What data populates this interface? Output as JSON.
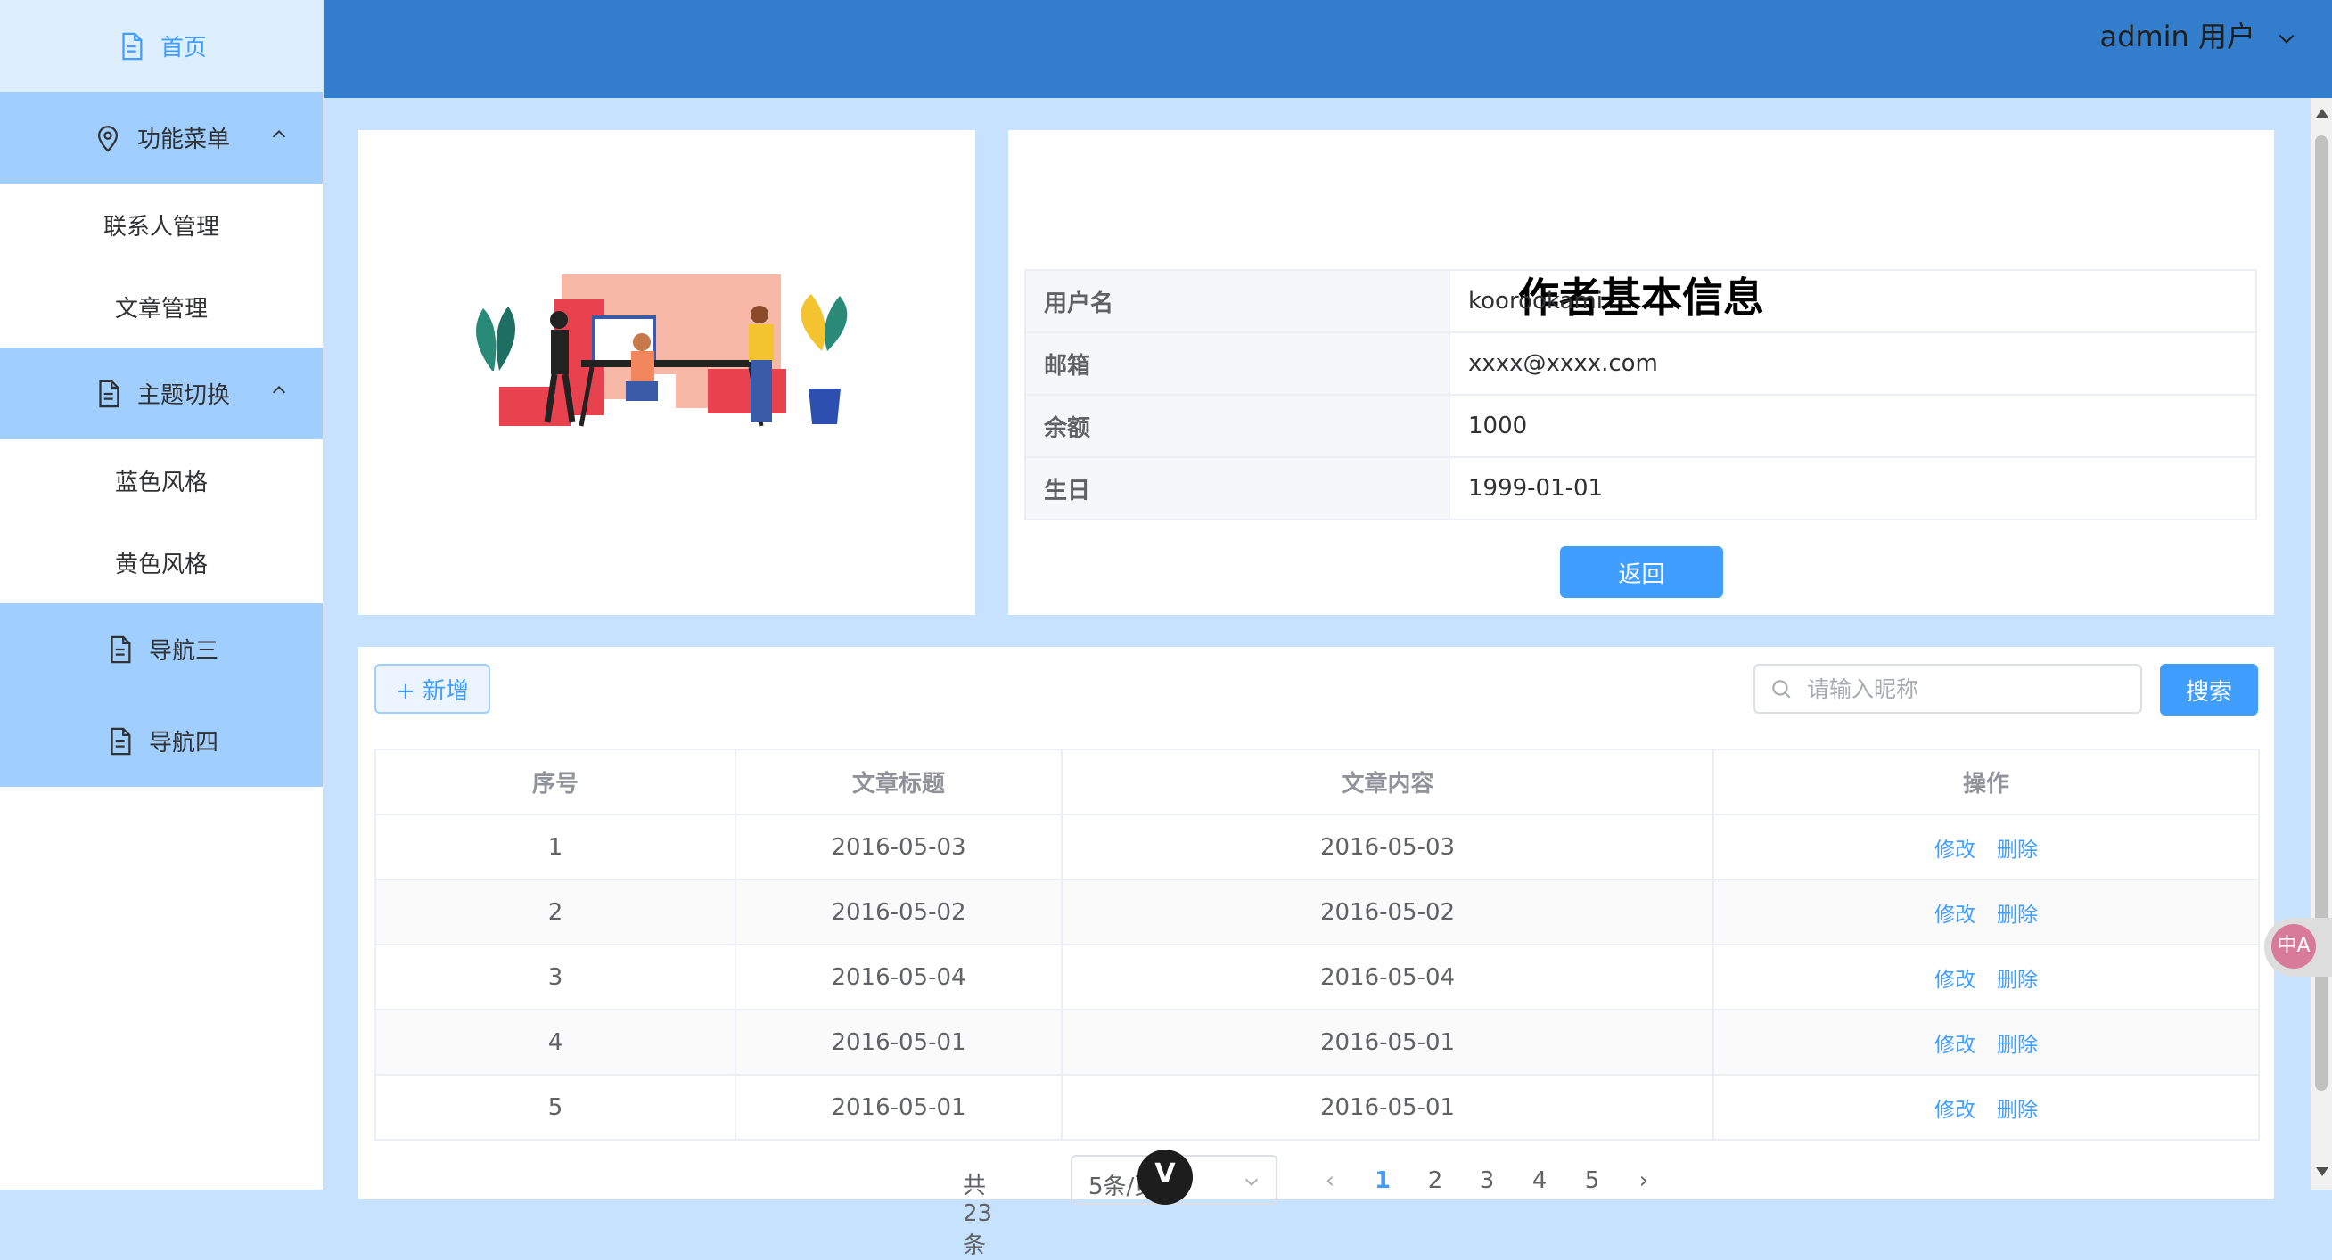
{
  "sidebar": {
    "home": "首页",
    "func_menu": "功能菜单",
    "func_children": [
      "联系人管理",
      "文章管理"
    ],
    "theme_menu": "主题切换",
    "theme_children": [
      "蓝色风格",
      "黄色风格"
    ],
    "nav3": "导航三",
    "nav4": "导航四"
  },
  "header": {
    "user": "admin 用户"
  },
  "author": {
    "title": "作者基本信息",
    "rows": [
      {
        "label": "用户名",
        "value": "koorookami"
      },
      {
        "label": "邮箱",
        "value": "xxxx@xxxx.com"
      },
      {
        "label": "余额",
        "value": "1000"
      },
      {
        "label": "生日",
        "value": "1999-01-01"
      }
    ],
    "back_button": "返回"
  },
  "toolbar": {
    "add_button": "+ 新增",
    "search_placeholder": "请输入昵称",
    "search_button": "搜索"
  },
  "table": {
    "columns": [
      "序号",
      "文章标题",
      "文章内容",
      "操作"
    ],
    "rows": [
      {
        "index": "1",
        "title": "2016-05-03",
        "content": "2016-05-03"
      },
      {
        "index": "2",
        "title": "2016-05-02",
        "content": "2016-05-02"
      },
      {
        "index": "3",
        "title": "2016-05-04",
        "content": "2016-05-04"
      },
      {
        "index": "4",
        "title": "2016-05-01",
        "content": "2016-05-01"
      },
      {
        "index": "5",
        "title": "2016-05-01",
        "content": "2016-05-01"
      }
    ],
    "edit_label": "修改",
    "delete_label": "删除"
  },
  "pagination": {
    "total": "共 23 条",
    "page_size": "5条/页",
    "pages": [
      "1",
      "2",
      "3",
      "4",
      "5"
    ],
    "prev": "‹",
    "next": "›"
  },
  "badges": {
    "vue": "V",
    "translate": "中A"
  },
  "colors": {
    "header": "#337ecc",
    "accent": "#409eff",
    "menu_active": "#a0cfff",
    "background": "#c6e2ff"
  }
}
